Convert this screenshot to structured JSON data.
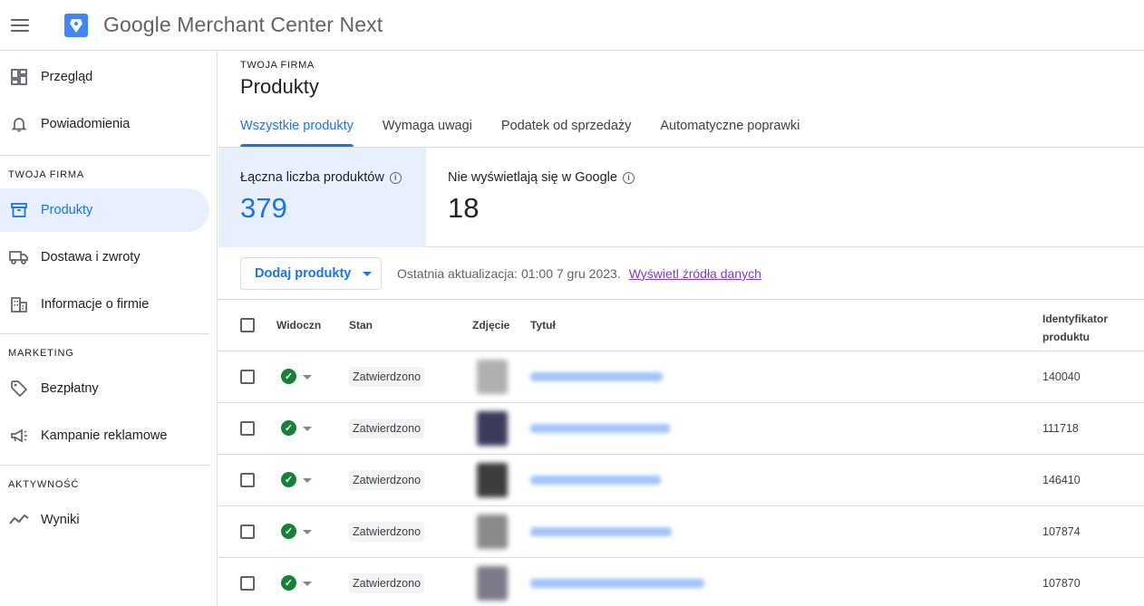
{
  "app": {
    "title_google": "Google",
    "title_rest": " Merchant Center Next"
  },
  "sidebar": {
    "items_top": [
      {
        "label": "Przegląd",
        "icon": "dashboard-icon"
      },
      {
        "label": "Powiadomienia",
        "icon": "bell-icon"
      }
    ],
    "sections": [
      {
        "label": "TWOJA FIRMA",
        "items": [
          {
            "label": "Produkty",
            "icon": "archive-icon",
            "active": true
          },
          {
            "label": "Dostawa i zwroty",
            "icon": "truck-icon"
          },
          {
            "label": "Informacje o firmie",
            "icon": "building-icon"
          }
        ]
      },
      {
        "label": "MARKETING",
        "items": [
          {
            "label": "Bezpłatny",
            "icon": "tag-icon"
          },
          {
            "label": "Kampanie reklamowe",
            "icon": "megaphone-icon"
          }
        ]
      },
      {
        "label": "AKTYWNOŚĆ",
        "items": [
          {
            "label": "Wyniki",
            "icon": "trend-icon"
          }
        ]
      }
    ]
  },
  "page": {
    "overline": "TWOJA FIRMA",
    "title": "Produkty"
  },
  "tabs": [
    {
      "label": "Wszystkie produkty",
      "active": true
    },
    {
      "label": "Wymaga uwagi"
    },
    {
      "label": "Podatek od sprzedaży"
    },
    {
      "label": "Automatyczne poprawki"
    }
  ],
  "stats": [
    {
      "label": "Łączna liczba produktów",
      "value": "379",
      "active": true
    },
    {
      "label": "Nie wyświetlają się w Google",
      "value": "18"
    }
  ],
  "toolbar": {
    "add_label": "Dodaj produkty",
    "updated_text": "Ostatnia aktualizacja: 01:00 7 gru 2023.",
    "source_link": "Wyświetl źródła danych"
  },
  "table": {
    "headers": {
      "visible": "Widoczn",
      "status": "Stan",
      "image": "Zdjęcie",
      "title": "Tytuł",
      "id_line1": "Identyfikator",
      "id_line2": "produktu"
    },
    "rows": [
      {
        "status": "Zatwierdzono",
        "id": "140040",
        "thumb_color": "#b0b0b0",
        "title_fraction": 0.58
      },
      {
        "status": "Zatwierdzono",
        "id": "111718",
        "thumb_color": "#3a3a5a",
        "title_fraction": 0.61
      },
      {
        "status": "Zatwierdzono",
        "id": "146410",
        "thumb_color": "#3d3d3d",
        "title_fraction": 0.57
      },
      {
        "status": "Zatwierdzono",
        "id": "107874",
        "thumb_color": "#8a8a8a",
        "title_fraction": 0.62
      },
      {
        "status": "Zatwierdzono",
        "id": "107870",
        "thumb_color": "#7a7a8a",
        "title_fraction": 0.76
      }
    ]
  },
  "colors": {
    "accent": "#1a73e8",
    "success": "#188038",
    "active_bg": "#e8f0fe",
    "link_visited": "#7b3fc4"
  }
}
